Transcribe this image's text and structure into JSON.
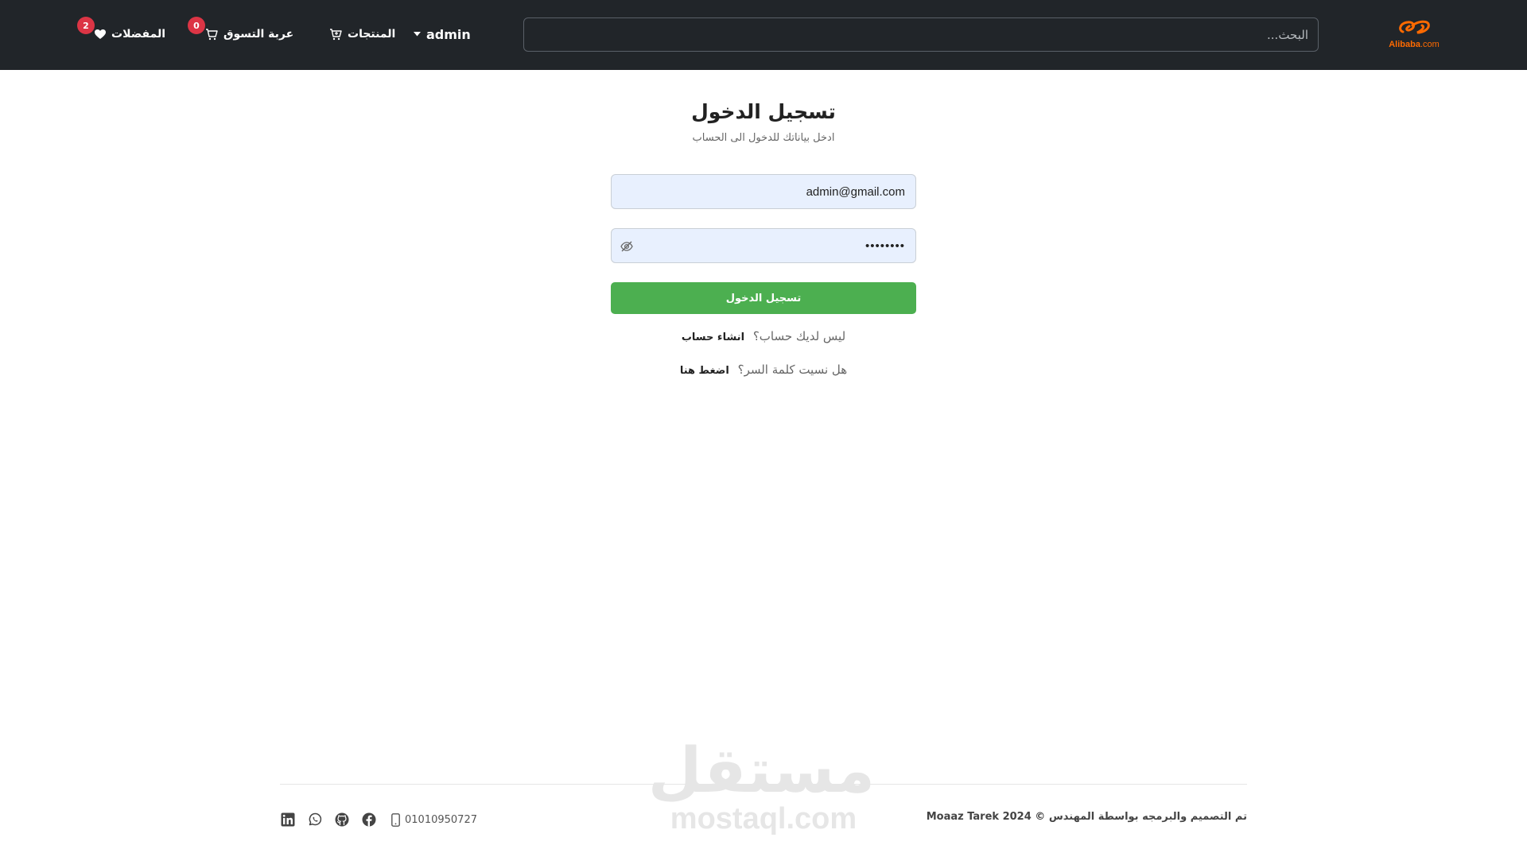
{
  "navbar": {
    "logo": {
      "brand": "Alibaba",
      "suffix": ".com",
      "color": "#ff6a00"
    },
    "search": {
      "placeholder": "البحث..."
    },
    "user": {
      "label": "admin"
    },
    "products": {
      "label": "المنتجات"
    },
    "cart": {
      "label": "عربة التسوق",
      "count": "0"
    },
    "favorites": {
      "label": "المفضلات",
      "count": "2"
    },
    "background_color": "#212529",
    "badge_color": "#dc3545"
  },
  "login": {
    "title": "تسجيل الدخول",
    "subtitle": "ادخل بياناتك للدخول الى الحساب",
    "email_value": "admin@gmail.com",
    "password_value": "••••••••",
    "submit_label": "تسجيل الدخول",
    "submit_color": "#4caf50",
    "register_prompt": "ليس لديك حساب؟",
    "register_link": "انشاء حساب",
    "forgot_prompt": "هل نسيت كلمة السر؟",
    "forgot_link": "اضغط هنا"
  },
  "footer": {
    "copyright": "تم التصميم والبرمجه بواسطة المهندس © 2024 Moaaz Tarek",
    "phone": "01010950727",
    "social": [
      "linkedin-icon",
      "whatsapp-icon",
      "github-icon",
      "facebook-icon"
    ]
  },
  "watermark": {
    "arabic": "مستقل",
    "latin": "mostaql.com"
  }
}
